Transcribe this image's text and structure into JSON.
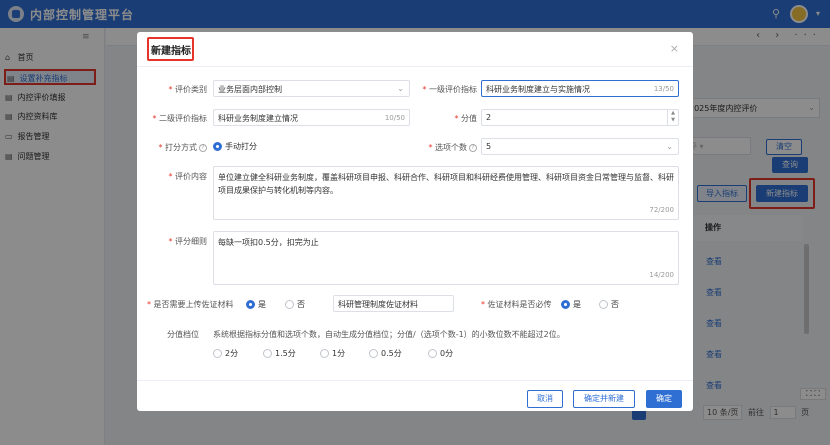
{
  "app": {
    "title": "内部控制管理平台",
    "search_icon": "search-icon",
    "user_avatar_icon": "avatar-icon",
    "caret": "▾"
  },
  "sidebar": {
    "toggle": "≡",
    "items": [
      {
        "label": "首页",
        "icon": "home-icon",
        "glyph": "⌂"
      },
      {
        "label": "设置补充指标",
        "icon": "doc-icon",
        "glyph": "▤"
      },
      {
        "label": "内控评价填报",
        "icon": "doc-icon",
        "glyph": "▤"
      },
      {
        "label": "内控资料库",
        "icon": "doc-icon",
        "glyph": "▤"
      },
      {
        "label": "报告管理",
        "icon": "folder-icon",
        "glyph": "▭"
      },
      {
        "label": "问题管理",
        "icon": "doc-icon",
        "glyph": "▤"
      }
    ]
  },
  "tabs_nav": "‹ › ···",
  "background": {
    "year_select": "2025年度内控评价",
    "status_select": "评 ▾",
    "clear_btn": "清空",
    "query_btn": "查询",
    "import_btn": "导入指标",
    "new_btn": "新建指标",
    "op_header": "操作",
    "row_link": "查看",
    "pager_size": "10 条/页",
    "pager_goto": "前往",
    "pager_page": "1",
    "pager_unit": "页",
    "fullscreen": "⛶ ⛶"
  },
  "modal": {
    "title": "新建指标",
    "close": "×",
    "fields": {
      "eval_category": {
        "label": "评价类别",
        "value": "业务层面内部控制"
      },
      "level1": {
        "label": "一级评价指标",
        "value": "科研业务制度建立与实施情况",
        "count": "13/50"
      },
      "level2": {
        "label": "二级评价指标",
        "value": "科研业务制度建立情况",
        "count": "10/50"
      },
      "score": {
        "label": "分值",
        "value": "2"
      },
      "scoring_method": {
        "label": "打分方式",
        "option": "手动打分"
      },
      "option_count": {
        "label": "选项个数",
        "value": "5"
      },
      "eval_content": {
        "label": "评价内容",
        "value": "单位建立健全科研业务制度，覆盖科研项目申报、科研合作、科研项目和科研经费使用管理、科研项目资金日常管理与监督、科研项目成果保护与转化机制等内容。",
        "count": "72/200"
      },
      "eval_detail": {
        "label": "评分细则",
        "value": "每缺一项扣0.5分，扣完为止",
        "count": "14/200"
      },
      "need_upload": {
        "label": "是否需要上传佐证材料",
        "yes": "是",
        "no": "否",
        "material": "科研管理制度佐证材料"
      },
      "required": {
        "label": "佐证材料是否必传",
        "yes": "是",
        "no": "否"
      },
      "score_levels": {
        "label": "分值档位",
        "hint": "系统根据指标分值和选项个数，自动生成分值档位；分值/（选项个数-1）的小数位数不能超过2位。",
        "options": [
          "2分",
          "1.5分",
          "1分",
          "0.5分",
          "0分"
        ]
      }
    },
    "buttons": {
      "cancel": "取消",
      "confirm_new": "确定并新建",
      "confirm": "确定"
    }
  },
  "colors": {
    "primary": "#2f6fd4",
    "highlight": "#e5342a"
  }
}
